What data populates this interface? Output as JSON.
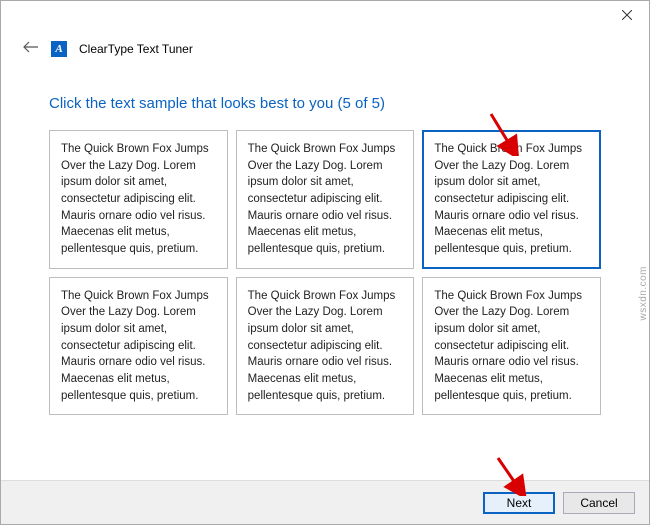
{
  "window": {
    "app_icon_glyph": "A",
    "app_title": "ClearType Text Tuner"
  },
  "instruction": "Click the text sample that looks best to you (5 of 5)",
  "sample_text": "The Quick Brown Fox Jumps Over the Lazy Dog. Lorem ipsum dolor sit amet, consectetur adipiscing elit. Mauris ornare odio vel risus. Maecenas elit metus, pellentesque quis, pretium.",
  "samples": [
    {
      "selected": false
    },
    {
      "selected": false
    },
    {
      "selected": true
    },
    {
      "selected": false
    },
    {
      "selected": false
    },
    {
      "selected": false
    }
  ],
  "footer": {
    "next_label": "Next",
    "cancel_label": "Cancel"
  },
  "watermark": "wsxdn.com"
}
